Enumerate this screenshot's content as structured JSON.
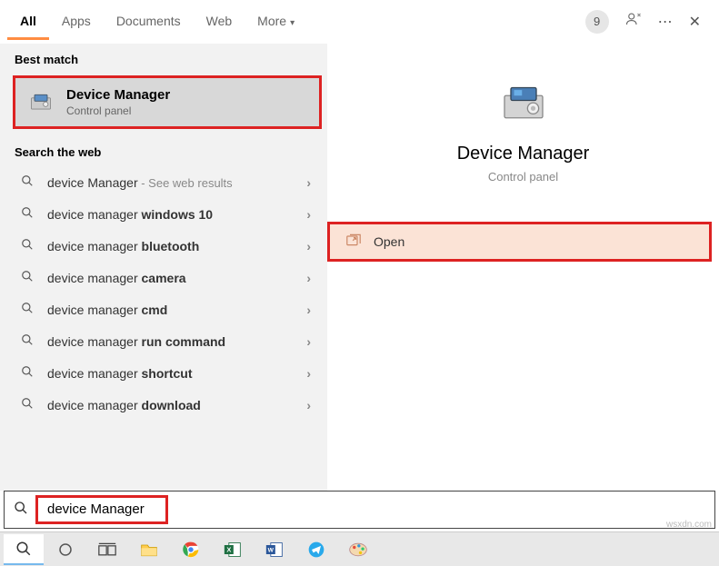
{
  "tabs": {
    "all": "All",
    "apps": "Apps",
    "documents": "Documents",
    "web": "Web",
    "more": "More",
    "badge": "9"
  },
  "left": {
    "best_match_header": "Best match",
    "best_match": {
      "title": "Device Manager",
      "subtitle": "Control panel"
    },
    "web_header": "Search the web",
    "items": [
      {
        "prefix": "device Manager",
        "bold": "",
        "hint": " - See web results"
      },
      {
        "prefix": "device manager ",
        "bold": "windows 10",
        "hint": ""
      },
      {
        "prefix": "device manager ",
        "bold": "bluetooth",
        "hint": ""
      },
      {
        "prefix": "device manager ",
        "bold": "camera",
        "hint": ""
      },
      {
        "prefix": "device manager ",
        "bold": "cmd",
        "hint": ""
      },
      {
        "prefix": "device manager ",
        "bold": "run command",
        "hint": ""
      },
      {
        "prefix": "device manager ",
        "bold": "shortcut",
        "hint": ""
      },
      {
        "prefix": "device manager ",
        "bold": "download",
        "hint": ""
      }
    ]
  },
  "right": {
    "title": "Device Manager",
    "subtitle": "Control panel",
    "action_open": "Open"
  },
  "search": {
    "value": "device Manager"
  },
  "watermark": "wsxdn.com"
}
